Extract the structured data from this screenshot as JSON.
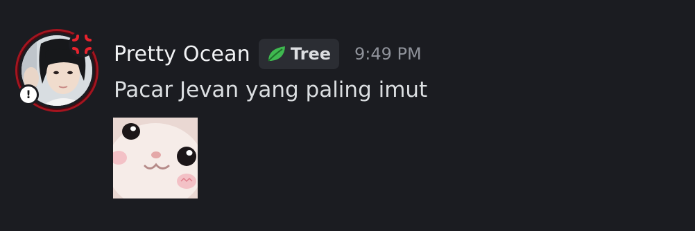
{
  "message": {
    "author": {
      "name": "Pretty Ocean",
      "avatar_icon": "avatar-photo",
      "status_icon": "exclamation-icon",
      "status_glyph": "!",
      "decoration_icon": "anger-symbol-icon"
    },
    "role_tag": {
      "icon": "leaf-icon",
      "label": "Tree",
      "icon_color": "#3fb950"
    },
    "timestamp": "9:49 PM",
    "text": "Pacar Jevan yang paling imut",
    "attachment": {
      "type": "sticker",
      "icon": "white-cat-sticker"
    }
  },
  "colors": {
    "background": "#1b1c21",
    "username": "#f2f3f5",
    "message_text": "#dbdee1",
    "timestamp": "#8f929a",
    "role_tag_bg": "#2b2d33",
    "avatar_ring": "#a5141f",
    "anger_symbol": "#e8222d"
  }
}
